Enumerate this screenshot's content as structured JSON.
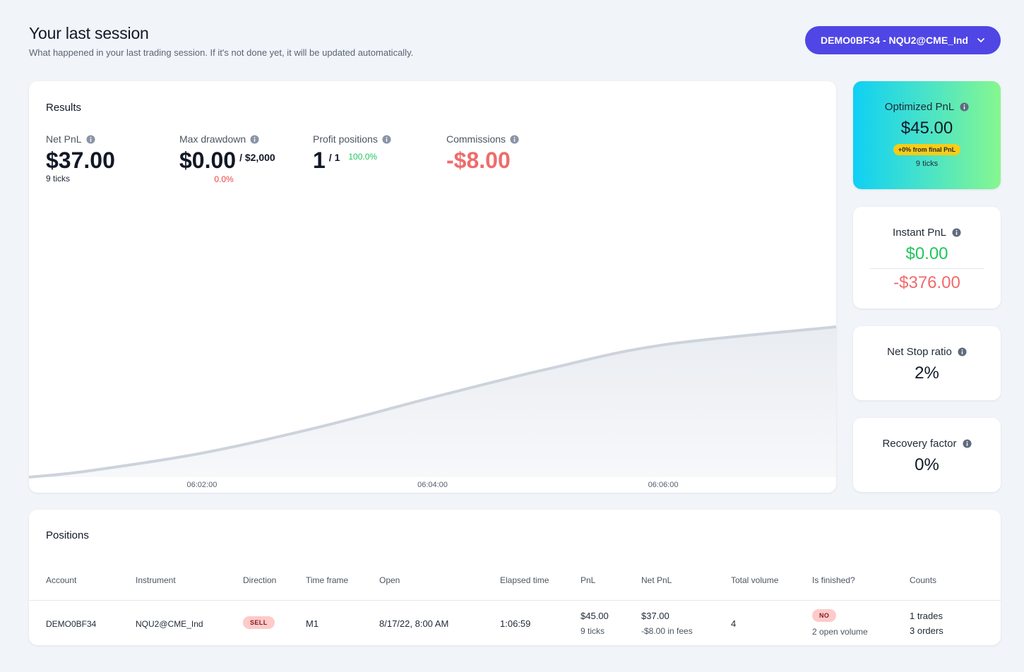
{
  "header": {
    "title": "Your last session",
    "subtitle": "What happened in your last trading session. If it's not done yet, it will be updated automatically."
  },
  "account_selector": {
    "label": "DEMO0BF34 - NQU2@CME_Ind",
    "icon": "chevron-down-icon"
  },
  "results": {
    "title": "Results",
    "net_pnl": {
      "label": "Net PnL",
      "value": "$37.00",
      "sub": "9 ticks"
    },
    "max_drawdown": {
      "label": "Max drawdown",
      "value": "$0.00",
      "limit": "/ $2,000",
      "pct": "0.0%"
    },
    "profit_positions": {
      "label": "Profit positions",
      "value": "1",
      "total": "/ 1",
      "pct": "100.0%"
    },
    "commissions": {
      "label": "Commissions",
      "value": "-$8.00"
    }
  },
  "chart_data": {
    "type": "area",
    "x": [
      "06:00:30",
      "06:01:00",
      "06:02:00",
      "06:03:00",
      "06:04:00",
      "06:05:00",
      "06:06:00",
      "06:07:30"
    ],
    "y_shape": [
      0.0,
      0.04,
      0.16,
      0.33,
      0.53,
      0.72,
      0.88,
      1.0
    ],
    "xticks": [
      "06:02:00",
      "06:04:00",
      "06:06:00"
    ],
    "grid": false,
    "colors": {
      "line": "#cdd3dc",
      "fill_top": "#e9ecf1",
      "fill_bottom": "#f7f8fa"
    }
  },
  "optimized": {
    "label": "Optimized PnL",
    "value": "$45.00",
    "badge": "+0% from final PnL",
    "sub": "9 ticks"
  },
  "instant": {
    "label": "Instant PnL",
    "value_pos": "$0.00",
    "value_neg": "-$376.00"
  },
  "net_stop": {
    "label": "Net Stop ratio",
    "value": "2%"
  },
  "recovery": {
    "label": "Recovery factor",
    "value": "0%"
  },
  "positions": {
    "title": "Positions",
    "columns": [
      "Account",
      "Instrument",
      "Direction",
      "Time frame",
      "Open",
      "Elapsed time",
      "PnL",
      "Net PnL",
      "Total volume",
      "Is finished?",
      "Counts"
    ],
    "rows": [
      {
        "account": "DEMO0BF34",
        "instrument": "NQU2@CME_Ind",
        "direction": "SELL",
        "timeframe": "M1",
        "open": "8/17/22, 8:00 AM",
        "elapsed": "1:06:59",
        "pnl": "$45.00",
        "pnl_sub": "9 ticks",
        "net_pnl": "$37.00",
        "net_pnl_sub": "-$8.00 in fees",
        "volume": "4",
        "finished": "NO",
        "finished_sub": "2 open volume",
        "trades": "1 trades",
        "orders": "3 orders"
      }
    ]
  },
  "colors": {
    "accent": "#4f46e5",
    "positive": "#22c55e",
    "negative": "#ef6b6b",
    "background": "#f1f4f8"
  }
}
